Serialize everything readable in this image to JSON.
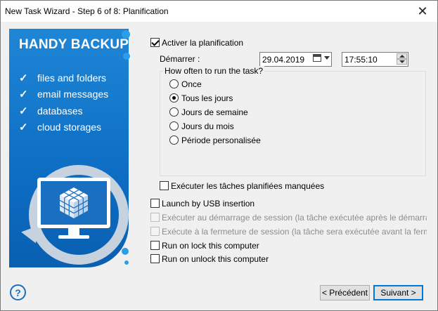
{
  "window": {
    "title": "New Task Wizard - Step 6 of 8: Planification",
    "close_glyph": "✕"
  },
  "banner": {
    "brand": "HANDY BACKUP",
    "features": [
      "files and folders",
      "email messages",
      "databases",
      "cloud storages"
    ],
    "colors": {
      "primary": "#0d6ec4",
      "accent": "#2a9ee8"
    }
  },
  "schedule": {
    "enable_label": "Activer la planification",
    "enable_checked": true,
    "start_label": "Démarrer :",
    "start_date": "29.04.2019",
    "start_time": "17:55:10",
    "group_title": "How often to run the task?",
    "options": [
      "Once",
      "Tous les jours",
      "Jours de semaine",
      "Jours du mois",
      "Période personalisée"
    ],
    "selected": "Tous les jours",
    "missed_label": "Exécuter les tâches planifiées manquées",
    "missed_checked": false
  },
  "triggers": {
    "usb": "Launch by USB insertion",
    "logon": "Exécuter au démarrage de session (la tâche exécutée après le démarrage de v",
    "logoff": "Exécute à la fermeture de session (la tâche sera exécutée avant la fermeture d",
    "lock": "Run on lock this computer",
    "unlock": "Run on unlock this computer"
  },
  "footer": {
    "help": "?",
    "prev": "< Précédent",
    "next": "Suivant >"
  }
}
